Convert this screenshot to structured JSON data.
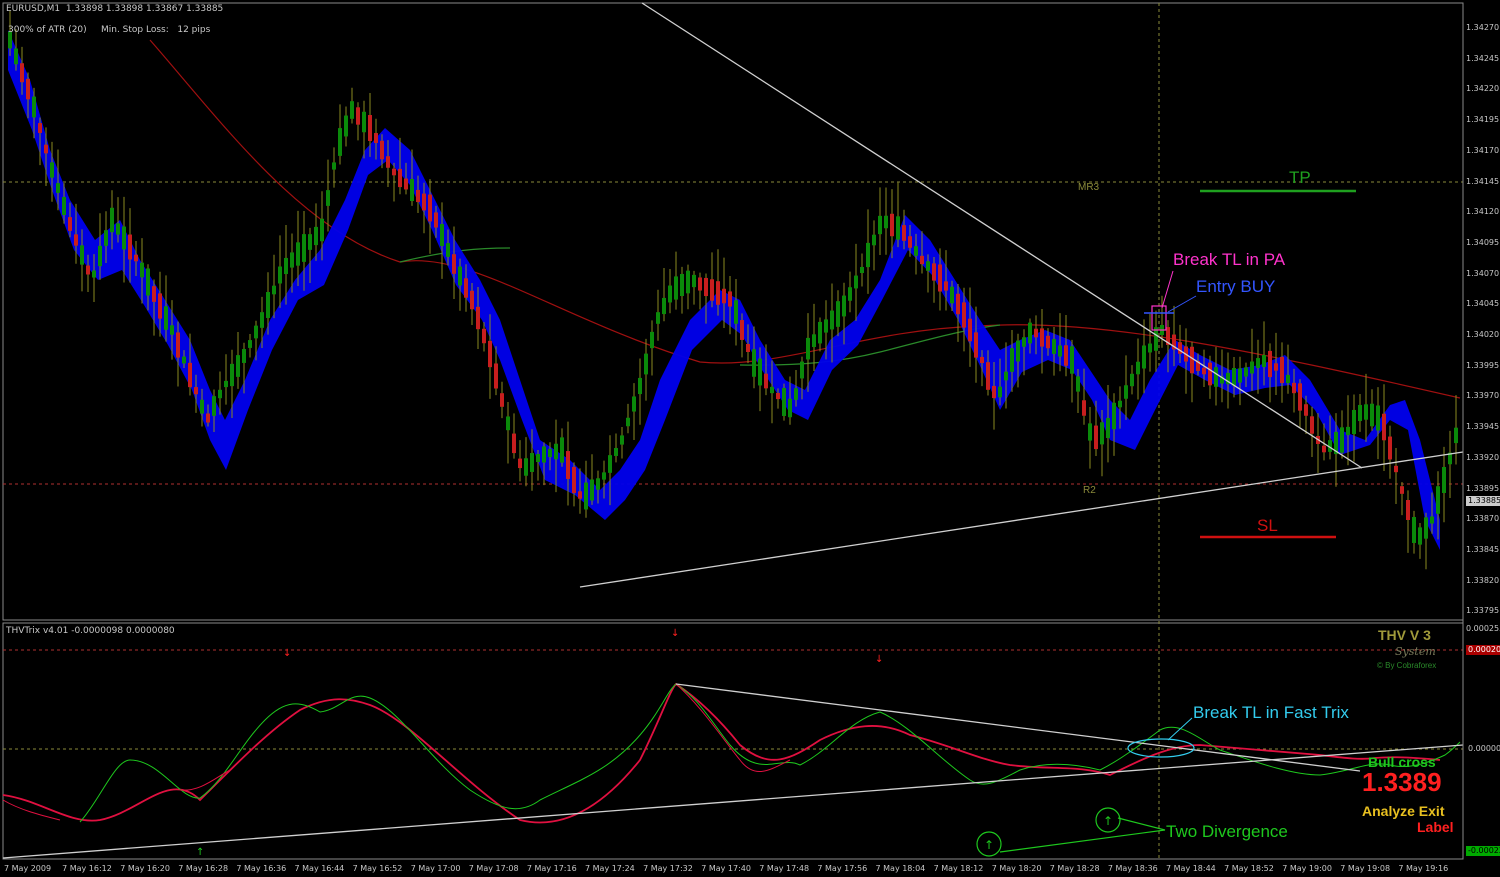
{
  "header": {
    "symbol_info": "EURUSD,M1  1.33898 1.33898 1.33867 1.33885",
    "atr_info": "300% of ATR (20)     Min. Stop Loss:   12 pips"
  },
  "indicator_header": "THVTrix v4.01 -0.0000098 0.0000080",
  "price_axis": [
    "1.34270",
    "1.34245",
    "1.34220",
    "1.34195",
    "1.34170",
    "1.34145",
    "1.34120",
    "1.34095",
    "1.34070",
    "1.34045",
    "1.34020",
    "1.33995",
    "1.33970",
    "1.33945",
    "1.33920",
    "1.33895",
    "1.33870",
    "1.33845",
    "1.33820",
    "1.33795"
  ],
  "current_price": "1.33885",
  "indicator_axis": {
    "top": "0.000255",
    "level_high": "0.00020",
    "zero": "0.00000",
    "bottom": "-0.00022"
  },
  "time_axis": [
    "7 May 2009",
    "7 May 16:12",
    "7 May 16:20",
    "7 May 16:28",
    "7 May 16:36",
    "7 May 16:44",
    "7 May 16:52",
    "7 May 17:00",
    "7 May 17:08",
    "7 May 17:16",
    "7 May 17:24",
    "7 May 17:32",
    "7 May 17:40",
    "7 May 17:48",
    "7 May 17:56",
    "7 May 18:04",
    "7 May 18:12",
    "7 May 18:20",
    "7 May 18:28",
    "7 May 18:36",
    "7 May 18:44",
    "7 May 18:52",
    "7 May 19:00",
    "7 May 19:08",
    "7 May 19:16"
  ],
  "pivots": {
    "mr3": "MR3",
    "r2": "R2"
  },
  "annotations": {
    "tp": "TP",
    "sl": "SL",
    "break_pa": "Break TL in PA",
    "entry_buy": "Entry BUY",
    "break_trix": "Break TL in Fast Trix",
    "two_divergence": "Two Divergence"
  },
  "branding": {
    "title": "THV V 3",
    "subtitle": "System",
    "credit": "© By Cobraforex"
  },
  "signal": {
    "bull_cross": "Bull cross",
    "price": "1.3389",
    "analyze_exit": "Analyze Exit",
    "label": "Label"
  },
  "colors": {
    "background": "#000000",
    "bull_candle": "#0a8a0a",
    "bear_candle": "#c81e1e",
    "ribbon": "#0000ee",
    "ma_line": "#a01010",
    "trendline": "#d0d0d0",
    "tp_line": "#1fa01f",
    "sl_line": "#d01010",
    "trix_fast": "#1ec81e",
    "trix_slow": "#e01040",
    "magenta": "#ff33cc",
    "cyan": "#33ccee",
    "gold": "#a09a3a",
    "price_tag": "#00aa00"
  }
}
